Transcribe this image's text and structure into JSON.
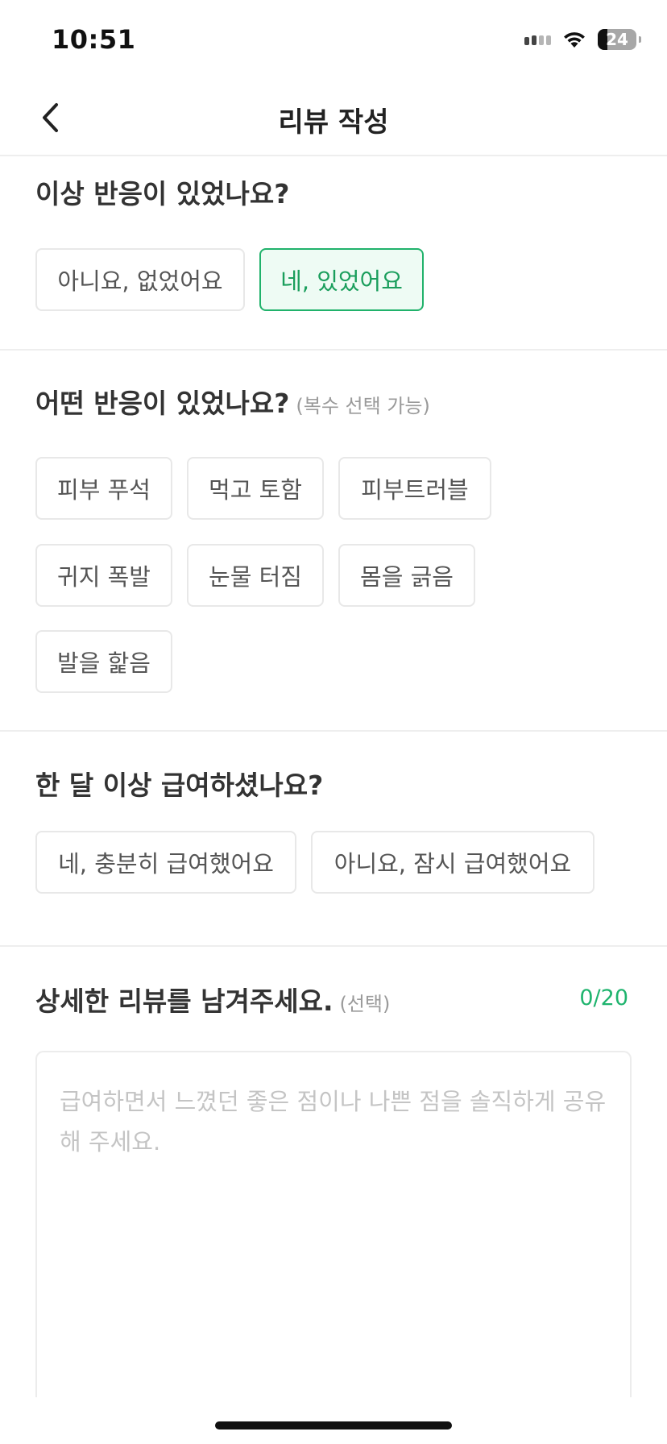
{
  "status_bar": {
    "time": "10:51",
    "battery": "24",
    "icons": [
      "signal-icon",
      "wifi-icon",
      "battery-icon"
    ]
  },
  "nav": {
    "title": "리뷰 작성",
    "back_icon": "chevron-left-icon"
  },
  "reaction": {
    "question": "이상 반응이 있었나요?",
    "options": [
      {
        "label": "아니요, 없었어요",
        "selected": false
      },
      {
        "label": "네, 있었어요",
        "selected": true
      }
    ]
  },
  "reaction_types": {
    "question": "어떤 반응이 있었나요?",
    "hint": "(복수 선택 가능)",
    "options": [
      {
        "label": "피부 푸석",
        "selected": false
      },
      {
        "label": "먹고 토함",
        "selected": false
      },
      {
        "label": "피부트러블",
        "selected": false
      },
      {
        "label": "귀지 폭발",
        "selected": false
      },
      {
        "label": "눈물 터짐",
        "selected": false
      },
      {
        "label": "몸을 긁음",
        "selected": false
      },
      {
        "label": "발을 핥음",
        "selected": false
      }
    ]
  },
  "duration": {
    "question": "한 달 이상 급여하셨나요?",
    "options": [
      {
        "label": "네, 충분히 급여했어요",
        "selected": false
      },
      {
        "label": "아니요, 잠시 급여했어요",
        "selected": false
      }
    ]
  },
  "detail_review": {
    "title": "상세한 리뷰를 남겨주세요.",
    "hint": "(선택)",
    "counter": "0/20",
    "value": "",
    "placeholder": "급여하면서 느꼈던 좋은 점이나 나쁜 점을 솔직하게 공유해 주세요."
  },
  "colors": {
    "accent": "#20b26b",
    "selected_bg": "#eefbf4",
    "divider": "#eeeeee",
    "placeholder": "#c4c4c4"
  }
}
